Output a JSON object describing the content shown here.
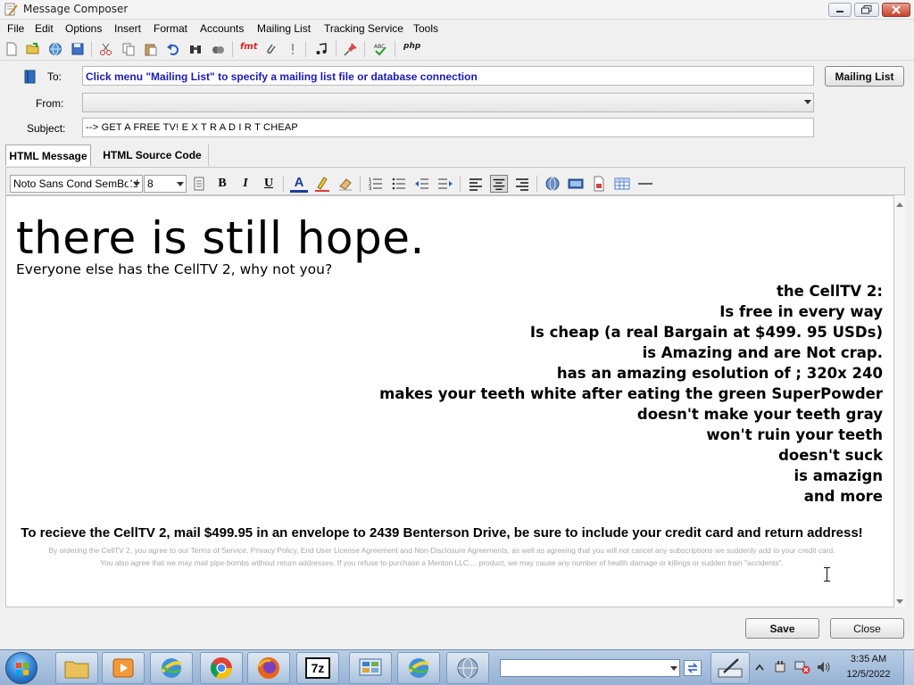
{
  "window": {
    "title": "Message Composer"
  },
  "menu": [
    "File",
    "Edit",
    "Options",
    "Insert",
    "Format",
    "Accounts",
    "Mailing List",
    "Tracking Service",
    "Tools"
  ],
  "toolbar": {
    "fmt_label": "fmt",
    "php_label": "php",
    "spell_label": "ABC"
  },
  "header": {
    "to_label": "To:",
    "to_hint": "Click menu \"Mailing List\" to specify a mailing list file or database connection",
    "from_label": "From:",
    "from_value": "",
    "subject_label": "Subject:",
    "subject_value": "-->   GET A FREE TV! E X T R A    D I R T CHEAP",
    "mailing_list_button": "Mailing List"
  },
  "tabs": [
    "HTML Message",
    "HTML Source Code"
  ],
  "format_bar": {
    "font_name": "Noto Sans Cond SemBold",
    "font_size": "8",
    "bold": "B",
    "italic": "I",
    "underline": "U",
    "font_color_letter": "A"
  },
  "editor": {
    "headline": "there is still hope.",
    "subline": "Everyone else has the CellTV 2, why not you?",
    "features": [
      "the CellTV 2:",
      "Is free in every way",
      "Is cheap (a real Bargain at $499. 95 USDs)",
      "is Amazing and are Not crap.",
      "has an amazing esolution of ; 320x 240",
      "makes your teeth white after eating the green SuperPowder",
      "doesn't make your teeth gray",
      "won't ruin your teeth",
      "doesn't suck",
      "is amazign",
      "and more"
    ],
    "cta": "To recieve the CellTV 2, mail $499.95 in an envelope to 2439 Benterson Drive, be sure to include your credit card and return address!",
    "fine_print_1": "By ordering the CellTV 2, you agree to our Terms of Service, Privacy Policy, End User License Agreement and Non-Disclosure Agreements, as well as agreeing that you will not cancel any subscriptions we suddenly add to your credit card.",
    "fine_print_2": "You also agree that we may mail pipe-bombs without return addresses. If you refuse to purchase a Menton LLC,... product, we may cause any number of health damage or killings or sudden train \"accidents\"."
  },
  "buttons": {
    "save": "Save",
    "close": "Close"
  },
  "taskbar": {
    "address_value": "",
    "time": "3:35 AM",
    "date": "12/5/2022",
    "zip_label": "7z"
  },
  "colors": {
    "to_hint": "#1a1ab8",
    "fine_print": "#a8a8a8",
    "taskbar": "#a8c1de"
  }
}
